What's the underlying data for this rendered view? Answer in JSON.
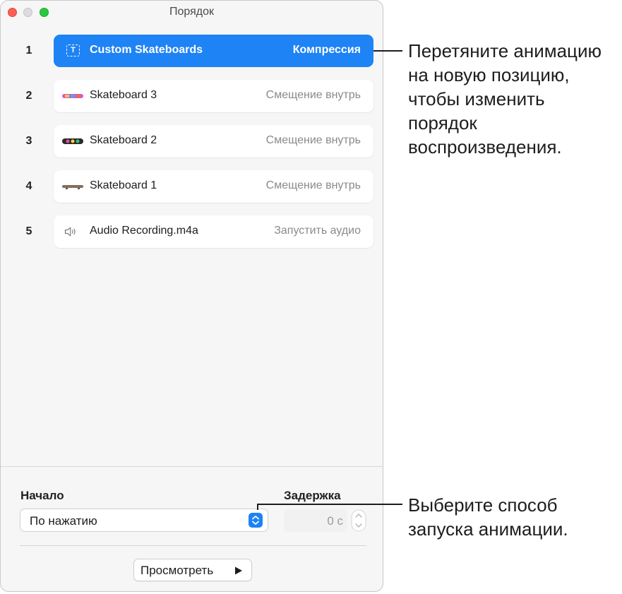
{
  "window": {
    "title": "Порядок"
  },
  "items": [
    {
      "num": "1",
      "name": "Custom Skateboards",
      "effect": "Компрессия",
      "selected": true,
      "icon": "text-box-icon"
    },
    {
      "num": "2",
      "name": "Skateboard 3",
      "effect": "Смещение внутрь",
      "icon": "skateboard-thumbnail-icon"
    },
    {
      "num": "3",
      "name": "Skateboard 2",
      "effect": "Смещение внутрь",
      "icon": "skateboard-thumbnail-icon"
    },
    {
      "num": "4",
      "name": "Skateboard 1",
      "effect": "Смещение внутрь",
      "icon": "skateboard-thumbnail-icon"
    },
    {
      "num": "5",
      "name": "Audio Recording.m4a",
      "effect": "Запустить аудио",
      "icon": "speaker-icon"
    }
  ],
  "start": {
    "label": "Начало",
    "value": "По нажатию"
  },
  "delay": {
    "label": "Задержка",
    "value": "0 с"
  },
  "preview": {
    "label": "Просмотреть"
  },
  "callouts": {
    "drag": "Перетяните анимацию на новую позицию, чтобы изменить порядок воспроизведения.",
    "start": "Выберите способ запуска анимации."
  },
  "colors": {
    "accent": "#1e83f5"
  }
}
